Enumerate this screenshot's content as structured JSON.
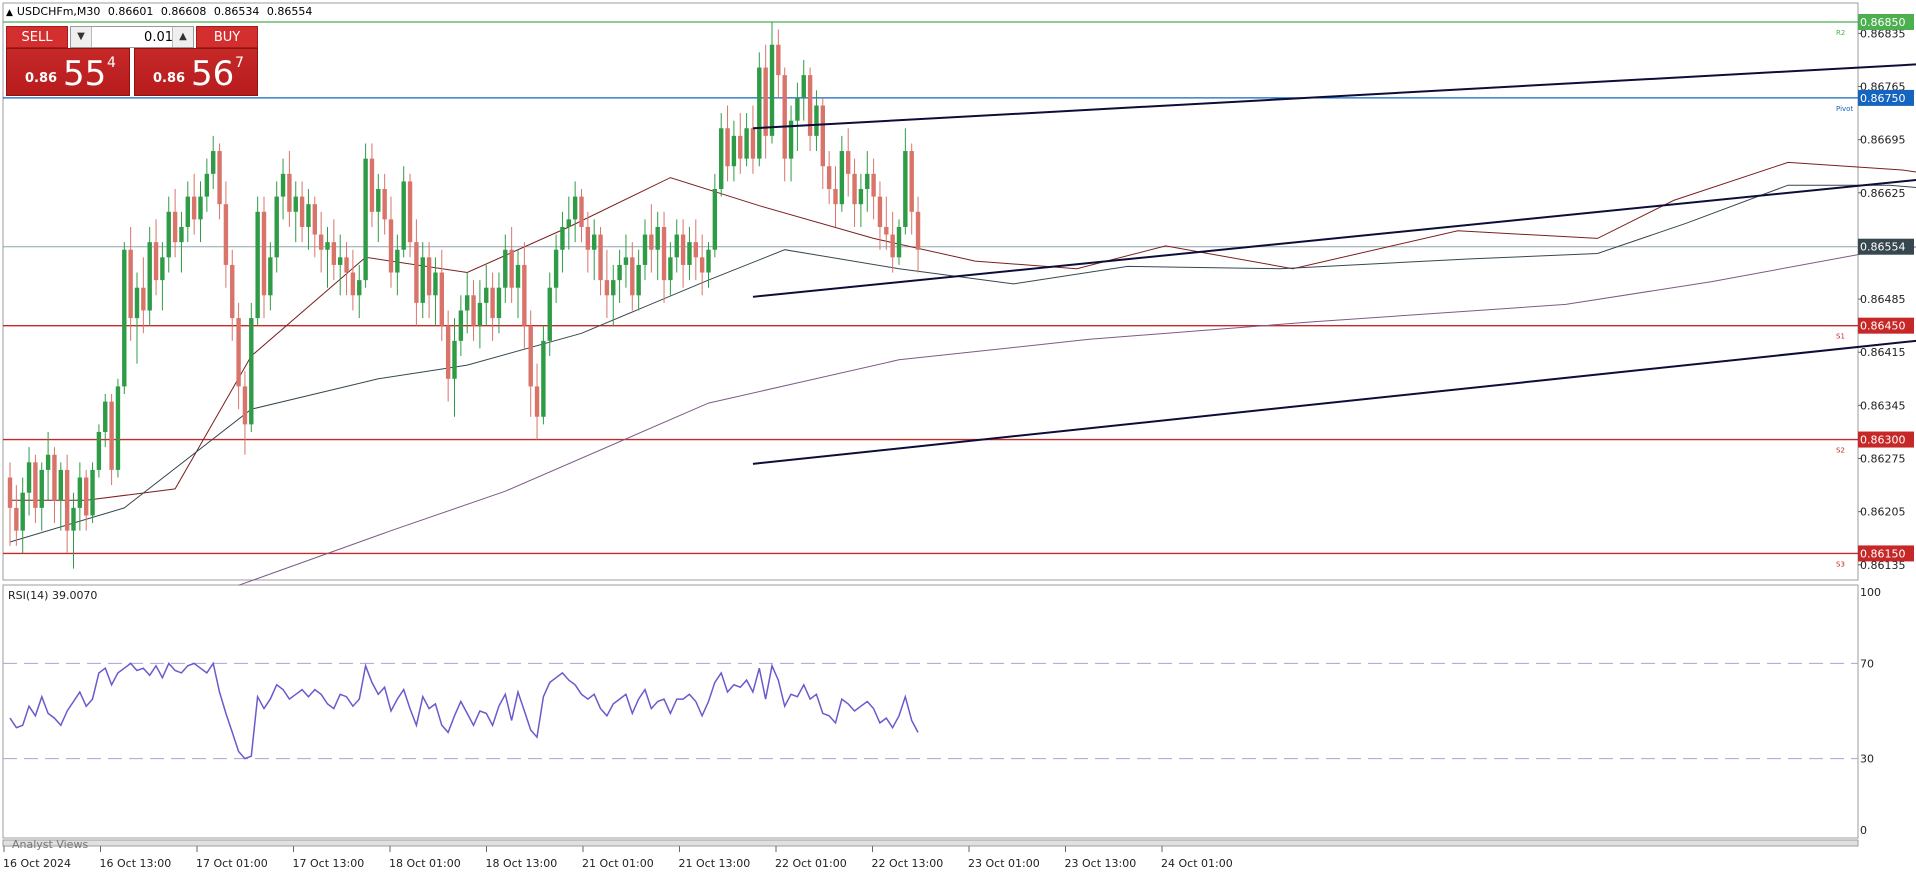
{
  "header": {
    "symbol": "USDCHFm,M30",
    "open": "0.86601",
    "high": "0.86608",
    "low": "0.86534",
    "close": "0.86554",
    "collapse_icon": "triangle-up-icon"
  },
  "trade_panel": {
    "sell_label": "SELL",
    "buy_label": "BUY",
    "volume": "0.01",
    "sell_price": {
      "small": "0.86",
      "big": "55",
      "sup": "4"
    },
    "buy_price": {
      "small": "0.86",
      "big": "56",
      "sup": "7"
    },
    "colors": {
      "button": "#d32f2f"
    }
  },
  "chart_data": {
    "type": "candlestick",
    "symbol": "USDCHFm",
    "timeframe": "M30",
    "ylim": [
      0.86115,
      0.86875
    ],
    "y_ticks": [
      "0.86835",
      "0.86765",
      "0.86695",
      "0.86625",
      "0.86485",
      "0.86415",
      "0.86345",
      "0.86275",
      "0.86205",
      "0.86135"
    ],
    "x_ticks": [
      "16 Oct 2024",
      "16 Oct 13:00",
      "17 Oct 01:00",
      "17 Oct 13:00",
      "18 Oct 01:00",
      "18 Oct 13:00",
      "21 Oct 01:00",
      "21 Oct 13:00",
      "22 Oct 01:00",
      "22 Oct 13:00",
      "23 Oct 01:00",
      "23 Oct 13:00",
      "24 Oct 01:00"
    ],
    "colors": {
      "up": "#2e9b46",
      "down": "#d9746b"
    },
    "current_price": {
      "value": 0.86554,
      "label": "0.86554",
      "color": "#37474f"
    },
    "levels": [
      {
        "value": 0.8685,
        "label": "0.86850",
        "tag": "R2",
        "color": "#4caf50"
      },
      {
        "value": 0.8675,
        "label": "0.86750",
        "tag": "Pivot",
        "color": "#1565c0"
      },
      {
        "value": 0.8645,
        "label": "0.86450",
        "tag": "S1",
        "color": "#c62828"
      },
      {
        "value": 0.863,
        "label": "0.86300",
        "tag": "S2",
        "color": "#c62828"
      },
      {
        "value": 0.8615,
        "label": "0.86150",
        "tag": "S3",
        "color": "#c62828"
      }
    ],
    "trend_lines": [
      {
        "from": [
          117,
          0.8671
        ],
        "to": [
          498,
          0.86885
        ]
      },
      {
        "from": [
          117,
          0.86488
        ],
        "to": [
          498,
          0.86808
        ]
      },
      {
        "from": [
          117,
          0.86268
        ],
        "to": [
          498,
          0.86605
        ]
      }
    ],
    "moving_averages": [
      {
        "color": "#7b1f1f",
        "points": [
          [
            0,
            0.8622
          ],
          [
            12,
            0.8622
          ],
          [
            26,
            0.86235
          ],
          [
            38,
            0.8641
          ],
          [
            56,
            0.8654
          ],
          [
            72,
            0.8652
          ],
          [
            88,
            0.8658
          ],
          [
            104,
            0.86645
          ],
          [
            118,
            0.86608
          ],
          [
            136,
            0.86565
          ],
          [
            152,
            0.86535
          ],
          [
            168,
            0.86525
          ],
          [
            182,
            0.86555
          ],
          [
            202,
            0.86525
          ],
          [
            228,
            0.86575
          ],
          [
            250,
            0.86565
          ],
          [
            262,
            0.86615
          ],
          [
            280,
            0.86665
          ],
          [
            298,
            0.86655
          ],
          [
            310,
            0.8664
          ],
          [
            320,
            0.8663
          ]
        ]
      },
      {
        "color": "#37474f",
        "points": [
          [
            0,
            0.86165
          ],
          [
            18,
            0.8621
          ],
          [
            38,
            0.8634
          ],
          [
            58,
            0.8638
          ],
          [
            72,
            0.86398
          ],
          [
            90,
            0.8644
          ],
          [
            110,
            0.8651
          ],
          [
            122,
            0.8655
          ],
          [
            140,
            0.86525
          ],
          [
            158,
            0.86505
          ],
          [
            176,
            0.86528
          ],
          [
            200,
            0.86525
          ],
          [
            230,
            0.86538
          ],
          [
            250,
            0.86545
          ],
          [
            264,
            0.86585
          ],
          [
            280,
            0.86635
          ],
          [
            296,
            0.86635
          ],
          [
            310,
            0.86625
          ],
          [
            320,
            0.86625
          ]
        ]
      },
      {
        "color": "#7e5a86",
        "points": [
          [
            36,
            0.86108
          ],
          [
            60,
            0.8618
          ],
          [
            78,
            0.86232
          ],
          [
            110,
            0.86348
          ],
          [
            140,
            0.86405
          ],
          [
            170,
            0.86432
          ],
          [
            205,
            0.86455
          ],
          [
            245,
            0.86478
          ],
          [
            268,
            0.86508
          ],
          [
            292,
            0.86545
          ],
          [
            320,
            0.86575
          ]
        ]
      }
    ],
    "candles": [
      [
        0.8625,
        0.8627,
        0.8616,
        0.8621
      ],
      [
        0.8621,
        0.8624,
        0.8616,
        0.8618
      ],
      [
        0.8618,
        0.8625,
        0.8615,
        0.8623
      ],
      [
        0.8623,
        0.8629,
        0.862,
        0.8627
      ],
      [
        0.8627,
        0.8628,
        0.8619,
        0.8621
      ],
      [
        0.8621,
        0.8627,
        0.8618,
        0.8626
      ],
      [
        0.8626,
        0.8631,
        0.8622,
        0.8628
      ],
      [
        0.8628,
        0.8629,
        0.8619,
        0.8622
      ],
      [
        0.8622,
        0.8627,
        0.8618,
        0.8626
      ],
      [
        0.8626,
        0.8628,
        0.8615,
        0.8618
      ],
      [
        0.8618,
        0.8623,
        0.8613,
        0.8621
      ],
      [
        0.8621,
        0.8627,
        0.8618,
        0.8625
      ],
      [
        0.8625,
        0.8626,
        0.8618,
        0.862
      ],
      [
        0.862,
        0.8627,
        0.8619,
        0.8626
      ],
      [
        0.8626,
        0.8632,
        0.8625,
        0.8631
      ],
      [
        0.8631,
        0.8636,
        0.8629,
        0.8635
      ],
      [
        0.8635,
        0.8636,
        0.8624,
        0.8626
      ],
      [
        0.8626,
        0.8638,
        0.8625,
        0.8637
      ],
      [
        0.8637,
        0.8656,
        0.8636,
        0.8655
      ],
      [
        0.8655,
        0.8658,
        0.8643,
        0.8646
      ],
      [
        0.8646,
        0.8652,
        0.864,
        0.865
      ],
      [
        0.865,
        0.8654,
        0.8644,
        0.8647
      ],
      [
        0.8647,
        0.8658,
        0.8645,
        0.8656
      ],
      [
        0.8656,
        0.8659,
        0.8649,
        0.8651
      ],
      [
        0.8651,
        0.8656,
        0.8647,
        0.8654
      ],
      [
        0.8654,
        0.8662,
        0.8652,
        0.866
      ],
      [
        0.866,
        0.8663,
        0.8654,
        0.8656
      ],
      [
        0.8656,
        0.866,
        0.8652,
        0.8658
      ],
      [
        0.8658,
        0.8664,
        0.8656,
        0.8662
      ],
      [
        0.8662,
        0.8665,
        0.8657,
        0.8659
      ],
      [
        0.8659,
        0.8664,
        0.8656,
        0.8662
      ],
      [
        0.8662,
        0.8667,
        0.866,
        0.8665
      ],
      [
        0.8665,
        0.867,
        0.8663,
        0.8668
      ],
      [
        0.8668,
        0.8669,
        0.8659,
        0.8661
      ],
      [
        0.8661,
        0.8664,
        0.865,
        0.8653
      ],
      [
        0.8653,
        0.8655,
        0.8643,
        0.8646
      ],
      [
        0.8646,
        0.8648,
        0.8634,
        0.8637
      ],
      [
        0.8637,
        0.8639,
        0.8628,
        0.8632
      ],
      [
        0.8632,
        0.8648,
        0.8631,
        0.8646
      ],
      [
        0.8646,
        0.8662,
        0.8645,
        0.866
      ],
      [
        0.866,
        0.8662,
        0.8646,
        0.8649
      ],
      [
        0.8649,
        0.8656,
        0.8647,
        0.8654
      ],
      [
        0.8654,
        0.8664,
        0.8652,
        0.8662
      ],
      [
        0.8662,
        0.8667,
        0.8659,
        0.8665
      ],
      [
        0.8665,
        0.8668,
        0.8658,
        0.866
      ],
      [
        0.866,
        0.8664,
        0.8656,
        0.8662
      ],
      [
        0.8662,
        0.8664,
        0.8656,
        0.8658
      ],
      [
        0.8658,
        0.8663,
        0.8655,
        0.8661
      ],
      [
        0.8661,
        0.8662,
        0.8654,
        0.8657
      ],
      [
        0.8657,
        0.866,
        0.8652,
        0.8655
      ],
      [
        0.8655,
        0.8658,
        0.865,
        0.8656
      ],
      [
        0.8656,
        0.8659,
        0.8651,
        0.8653
      ],
      [
        0.8653,
        0.8657,
        0.8649,
        0.8654
      ],
      [
        0.8654,
        0.8656,
        0.8649,
        0.8652
      ],
      [
        0.8652,
        0.8655,
        0.8647,
        0.8649
      ],
      [
        0.8649,
        0.8653,
        0.8646,
        0.8651
      ],
      [
        0.8651,
        0.8669,
        0.865,
        0.8667
      ],
      [
        0.8667,
        0.8669,
        0.8658,
        0.866
      ],
      [
        0.866,
        0.8665,
        0.8656,
        0.8663
      ],
      [
        0.8663,
        0.8665,
        0.8657,
        0.8659
      ],
      [
        0.8659,
        0.8662,
        0.865,
        0.8652
      ],
      [
        0.8652,
        0.8657,
        0.8649,
        0.8655
      ],
      [
        0.8655,
        0.8666,
        0.8654,
        0.8664
      ],
      [
        0.8664,
        0.8665,
        0.8654,
        0.8656
      ],
      [
        0.8656,
        0.8659,
        0.8645,
        0.8648
      ],
      [
        0.8648,
        0.8656,
        0.8646,
        0.8654
      ],
      [
        0.8654,
        0.8656,
        0.8646,
        0.8649
      ],
      [
        0.8649,
        0.8654,
        0.8645,
        0.8652
      ],
      [
        0.8652,
        0.8655,
        0.8643,
        0.8645
      ],
      [
        0.8645,
        0.8647,
        0.8635,
        0.8638
      ],
      [
        0.8638,
        0.8646,
        0.8633,
        0.8643
      ],
      [
        0.8643,
        0.8649,
        0.8641,
        0.8647
      ],
      [
        0.8647,
        0.8652,
        0.8644,
        0.8649
      ],
      [
        0.8649,
        0.8651,
        0.8643,
        0.8645
      ],
      [
        0.8645,
        0.8651,
        0.8642,
        0.8648
      ],
      [
        0.8648,
        0.8653,
        0.8645,
        0.865
      ],
      [
        0.865,
        0.8652,
        0.8643,
        0.8646
      ],
      [
        0.8646,
        0.8652,
        0.8644,
        0.865
      ],
      [
        0.865,
        0.8657,
        0.8648,
        0.8655
      ],
      [
        0.8655,
        0.8658,
        0.8648,
        0.865
      ],
      [
        0.865,
        0.8655,
        0.8646,
        0.8653
      ],
      [
        0.8653,
        0.8656,
        0.8642,
        0.8645
      ],
      [
        0.8645,
        0.8647,
        0.8633,
        0.8637
      ],
      [
        0.8637,
        0.864,
        0.863,
        0.8633
      ],
      [
        0.8633,
        0.8645,
        0.8632,
        0.8643
      ],
      [
        0.8643,
        0.8652,
        0.8641,
        0.865
      ],
      [
        0.865,
        0.8657,
        0.8648,
        0.8655
      ],
      [
        0.8655,
        0.866,
        0.8652,
        0.8658
      ],
      [
        0.8658,
        0.8662,
        0.8655,
        0.8659
      ],
      [
        0.8659,
        0.8664,
        0.8656,
        0.8662
      ],
      [
        0.8662,
        0.8663,
        0.8656,
        0.8658
      ],
      [
        0.8658,
        0.866,
        0.8652,
        0.8655
      ],
      [
        0.8655,
        0.8659,
        0.8651,
        0.8657
      ],
      [
        0.8657,
        0.8658,
        0.8649,
        0.8651
      ],
      [
        0.8651,
        0.8655,
        0.8646,
        0.8649
      ],
      [
        0.8649,
        0.8653,
        0.8645,
        0.8651
      ],
      [
        0.8651,
        0.8655,
        0.8648,
        0.8653
      ],
      [
        0.8653,
        0.8657,
        0.865,
        0.8654
      ],
      [
        0.8654,
        0.8656,
        0.8647,
        0.8649
      ],
      [
        0.8649,
        0.8655,
        0.8647,
        0.8653
      ],
      [
        0.8653,
        0.8659,
        0.8651,
        0.8657
      ],
      [
        0.8657,
        0.8661,
        0.8652,
        0.8655
      ],
      [
        0.8655,
        0.866,
        0.8651,
        0.8658
      ],
      [
        0.8658,
        0.866,
        0.8648,
        0.8651
      ],
      [
        0.8651,
        0.8656,
        0.8649,
        0.8654
      ],
      [
        0.8654,
        0.8659,
        0.8652,
        0.8657
      ],
      [
        0.8657,
        0.8659,
        0.865,
        0.8653
      ],
      [
        0.8653,
        0.8658,
        0.8651,
        0.8656
      ],
      [
        0.8656,
        0.8659,
        0.8651,
        0.8654
      ],
      [
        0.8654,
        0.8657,
        0.8649,
        0.8652
      ],
      [
        0.8652,
        0.8656,
        0.865,
        0.8655
      ],
      [
        0.8655,
        0.8665,
        0.8654,
        0.8663
      ],
      [
        0.8663,
        0.8673,
        0.8662,
        0.8671
      ],
      [
        0.8671,
        0.8674,
        0.8664,
        0.8666
      ],
      [
        0.8666,
        0.8672,
        0.8664,
        0.867
      ],
      [
        0.867,
        0.8673,
        0.8665,
        0.8667
      ],
      [
        0.8667,
        0.8673,
        0.8666,
        0.8671
      ],
      [
        0.8671,
        0.8674,
        0.8665,
        0.8667
      ],
      [
        0.8667,
        0.8681,
        0.8666,
        0.8679
      ],
      [
        0.8679,
        0.8682,
        0.8667,
        0.867
      ],
      [
        0.867,
        0.8685,
        0.8669,
        0.8682
      ],
      [
        0.8682,
        0.8684,
        0.8675,
        0.8678
      ],
      [
        0.8678,
        0.8679,
        0.8664,
        0.8667
      ],
      [
        0.8667,
        0.8674,
        0.8664,
        0.8672
      ],
      [
        0.8672,
        0.8677,
        0.8668,
        0.8675
      ],
      [
        0.8675,
        0.868,
        0.8672,
        0.8678
      ],
      [
        0.8678,
        0.8679,
        0.8668,
        0.867
      ],
      [
        0.867,
        0.8676,
        0.8668,
        0.8674
      ],
      [
        0.8674,
        0.8675,
        0.8663,
        0.8666
      ],
      [
        0.8666,
        0.8668,
        0.8661,
        0.8663
      ],
      [
        0.8663,
        0.8666,
        0.8658,
        0.8661
      ],
      [
        0.8661,
        0.867,
        0.866,
        0.8668
      ],
      [
        0.8668,
        0.8671,
        0.8662,
        0.8665
      ],
      [
        0.8665,
        0.8667,
        0.8658,
        0.8661
      ],
      [
        0.8661,
        0.8665,
        0.8658,
        0.8663
      ],
      [
        0.8663,
        0.8668,
        0.866,
        0.8665
      ],
      [
        0.8665,
        0.8667,
        0.8659,
        0.8662
      ],
      [
        0.8662,
        0.8664,
        0.8655,
        0.8658
      ],
      [
        0.8658,
        0.8662,
        0.8655,
        0.8657
      ],
      [
        0.8657,
        0.866,
        0.8652,
        0.8654
      ],
      [
        0.8654,
        0.8659,
        0.8653,
        0.8658
      ],
      [
        0.8658,
        0.8671,
        0.8657,
        0.8668
      ],
      [
        0.8668,
        0.8669,
        0.8657,
        0.866
      ],
      [
        0.866,
        0.8662,
        0.8652,
        0.8655
      ]
    ]
  },
  "rsi": {
    "title": "RSI(14) 39.0070",
    "ylim": [
      0,
      100
    ],
    "levels": [
      30,
      70
    ],
    "y_ticks": [
      "100",
      "70",
      "30",
      "0"
    ],
    "color": "#6a5acd",
    "values": [
      47,
      43,
      44,
      52,
      48,
      56,
      49,
      47,
      44,
      50,
      54,
      58,
      52,
      55,
      66,
      68,
      61,
      66,
      68,
      70,
      67,
      68,
      65,
      69,
      64,
      70,
      67,
      66,
      69,
      70,
      68,
      66,
      70,
      58,
      49,
      41,
      33,
      30,
      31,
      56,
      51,
      55,
      61,
      59,
      55,
      57,
      59,
      56,
      59,
      57,
      53,
      51,
      57,
      56,
      52,
      55,
      69,
      62,
      57,
      60,
      50,
      55,
      59,
      51,
      44,
      56,
      51,
      53,
      44,
      41,
      48,
      54,
      49,
      44,
      50,
      49,
      44,
      52,
      57,
      46,
      58,
      50,
      42,
      39,
      56,
      62,
      64,
      66,
      63,
      61,
      57,
      55,
      57,
      51,
      48,
      53,
      55,
      57,
      49,
      55,
      59,
      51,
      54,
      55,
      49,
      55,
      55,
      57,
      54,
      48,
      54,
      62,
      66,
      58,
      61,
      60,
      63,
      58,
      68,
      55,
      69,
      63,
      52,
      57,
      56,
      61,
      55,
      57,
      49,
      48,
      45,
      55,
      53,
      50,
      52,
      54,
      51,
      45,
      47,
      43,
      48,
      56,
      46,
      41
    ]
  },
  "x_axis": {
    "labels": [
      "16 Oct 2024",
      "16 Oct 13:00",
      "17 Oct 01:00",
      "17 Oct 13:00",
      "18 Oct 01:00",
      "18 Oct 13:00",
      "21 Oct 01:00",
      "21 Oct 13:00",
      "22 Oct 01:00",
      "22 Oct 13:00",
      "23 Oct 01:00",
      "23 Oct 13:00",
      "24 Oct 01:00"
    ]
  },
  "footer": {
    "analyst_views": "Analyst Views"
  }
}
